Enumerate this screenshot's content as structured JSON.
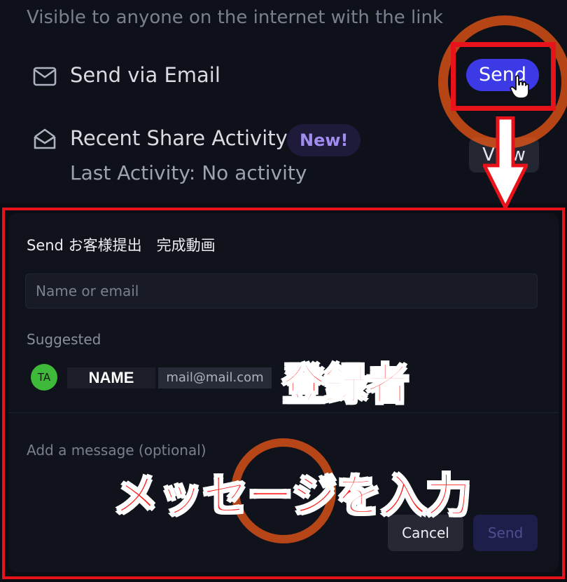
{
  "share_panel": {
    "visibility_note": "Visible to anyone on the internet with the link",
    "send_via_email": {
      "label": "Send via Email",
      "button_label": "Send",
      "icon": "envelope-icon"
    },
    "recent_activity": {
      "label": "Recent Share Activity",
      "badge": "New!",
      "status": "Last Activity: No activity",
      "button_label": "View",
      "icon": "inbox-icon"
    }
  },
  "send_dialog": {
    "title": "Send お客様提出　完成動画",
    "recipient_input": {
      "placeholder": "Name or email",
      "value": ""
    },
    "suggested_label": "Suggested",
    "suggestions": [
      {
        "initials": "TA",
        "name": "NAME",
        "email": "mail@mail.com",
        "avatar_color": "#3fb93a"
      }
    ],
    "message_placeholder": "Add a message (optional)",
    "cancel_label": "Cancel",
    "send_label": "Send"
  },
  "annotations": {
    "registrant_caption": "登録者",
    "message_caption": "メッセージを入力",
    "highlight_color": "#e8121a",
    "ring_color": "#e65416"
  },
  "colors": {
    "accent": "#3b3ae6",
    "background": "#0f111a",
    "badge_text": "#a38cf0"
  }
}
